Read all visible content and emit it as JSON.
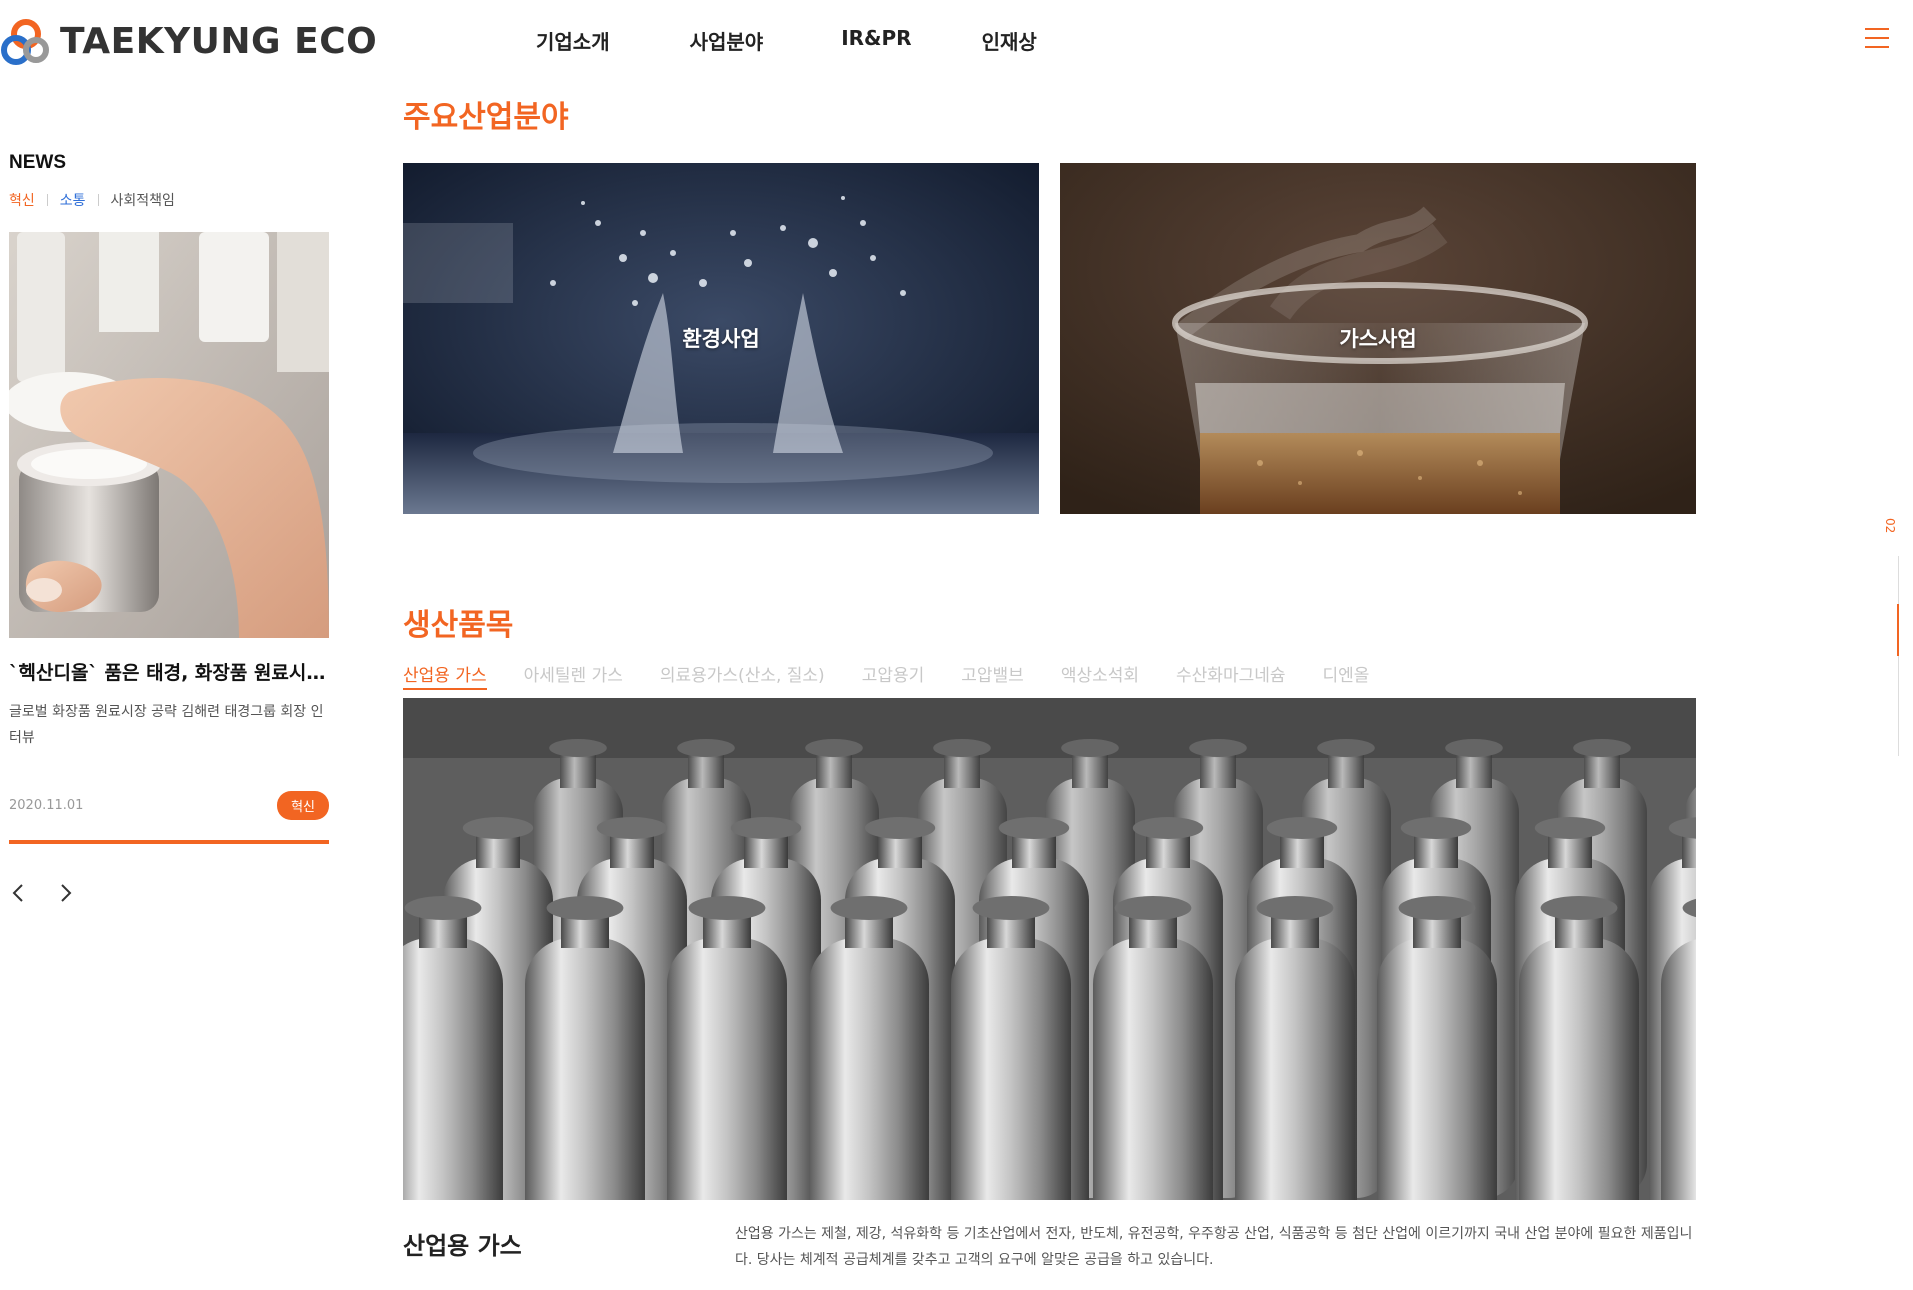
{
  "header": {
    "logo_text": "TAEKYUNG ECO",
    "nav": [
      "기업소개",
      "사업분야",
      "IR&PR",
      "인재상"
    ],
    "menu_icon": "hamburger-icon"
  },
  "news": {
    "title": "NEWS",
    "categories": [
      "혁신",
      "소통",
      "사회적책임"
    ],
    "headline": "`헥산디올` 품은 태경, 화장품 원료시장...",
    "description": "글로벌 화장품 원료시장 공략 김해련 태경그룹 회장 인터뷰",
    "date": "2020.11.01",
    "badge": "혁신",
    "prev_icon": "chevron-left-icon",
    "next_icon": "chevron-right-icon"
  },
  "main": {
    "section1_title": "주요산업분야",
    "business_cards": [
      {
        "label": "환경사업"
      },
      {
        "label": "가스사업"
      }
    ],
    "section2_title": "생산품목",
    "product_tabs": [
      "산업용 가스",
      "아세틸렌 가스",
      "의료용가스(산소, 질소)",
      "고압용기",
      "고압밸브",
      "액상소석회",
      "수산화마그네슘",
      "디엔올"
    ],
    "active_tab": "산업용 가스",
    "product_name": "산업용 가스",
    "product_description": "산업용 가스는 제철, 제강, 석유화학 등 기초산업에서 전자, 반도체, 유전공학, 우주항공 산업, 식품공학 등 첨단 산업에 이르기까지 국내 산업 분야에 필요한 제품입니다. 당사는 체계적 공급체계를 갖추고 고객의 요구에 알맞은 공급을 하고 있습니다."
  },
  "indicator": {
    "page": "02"
  },
  "colors": {
    "accent": "#f26522",
    "link_blue": "#2f6fd8"
  }
}
